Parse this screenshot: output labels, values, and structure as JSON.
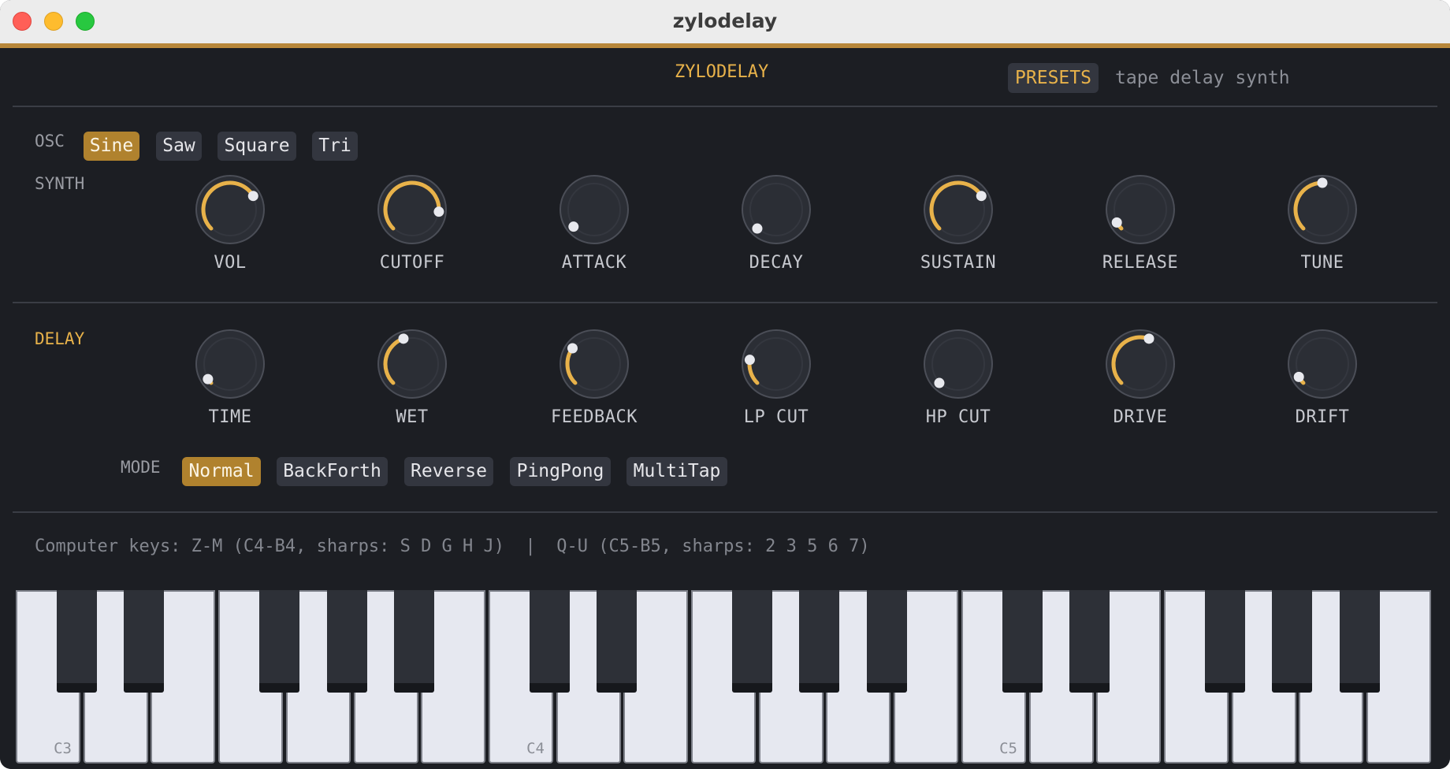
{
  "window": {
    "title": "zylodelay"
  },
  "header": {
    "brand": "ZYLODELAY",
    "presets_label": "PRESETS",
    "tagline": "tape delay synth"
  },
  "colors": {
    "accent": "#e8b24a",
    "active_button": "#b0822e",
    "panel": "#1c1e23",
    "button": "#33363f"
  },
  "osc": {
    "label": "OSC",
    "options": [
      "Sine",
      "Saw",
      "Square",
      "Tri"
    ],
    "selected": "Sine"
  },
  "synth": {
    "label": "SYNTH",
    "knobs": [
      {
        "label": "VOL",
        "value": 0.72
      },
      {
        "label": "CUTOFF",
        "value": 0.85
      },
      {
        "label": "ATTACK",
        "value": 0.02
      },
      {
        "label": "DECAY",
        "value": 0.0
      },
      {
        "label": "SUSTAIN",
        "value": 0.72
      },
      {
        "label": "RELEASE",
        "value": 0.06
      },
      {
        "label": "TUNE",
        "value": 0.5
      }
    ]
  },
  "delay": {
    "label": "DELAY",
    "knobs": [
      {
        "label": "TIME",
        "value": 0.04
      },
      {
        "label": "WET",
        "value": 0.43
      },
      {
        "label": "FEEDBACK",
        "value": 0.3
      },
      {
        "label": "LP CUT",
        "value": 0.2
      },
      {
        "label": "HP CUT",
        "value": 0.0
      },
      {
        "label": "DRIVE",
        "value": 0.57
      },
      {
        "label": "DRIFT",
        "value": 0.06
      }
    ],
    "mode_label": "MODE",
    "modes": [
      "Normal",
      "BackForth",
      "Reverse",
      "PingPong",
      "MultiTap"
    ],
    "selected_mode": "Normal"
  },
  "hint": "Computer keys: Z-M (C4-B4, sharps: S D G H J)  |  Q-U (C5-B5, sharps: 2 3 5 6 7)",
  "keyboard": {
    "octave_labels": [
      "C3",
      "C4",
      "C5"
    ]
  }
}
